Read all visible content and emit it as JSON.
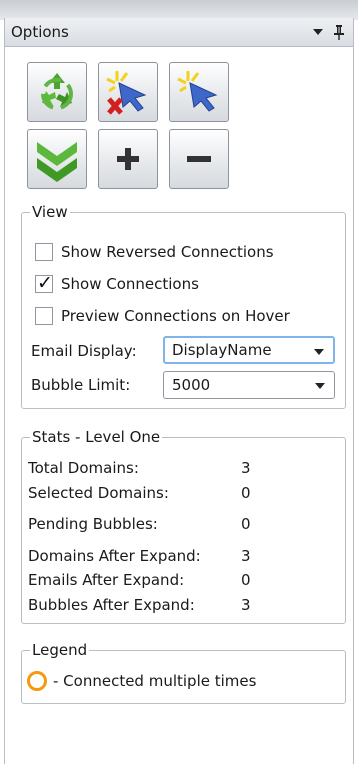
{
  "panel": {
    "title": "Options"
  },
  "toolbar": {
    "buttons": [
      {
        "name": "refresh",
        "icon": "recycle-icon"
      },
      {
        "name": "clear-selection",
        "icon": "cursor-x-icon"
      },
      {
        "name": "select",
        "icon": "cursor-sparkle-icon"
      },
      {
        "name": "expand",
        "icon": "double-chevron-down-icon"
      },
      {
        "name": "zoom-in",
        "icon": "plus-icon",
        "label": "+"
      },
      {
        "name": "zoom-out",
        "icon": "minus-icon",
        "label": "−"
      }
    ]
  },
  "view": {
    "legend": "View",
    "options": [
      {
        "label": "Show Reversed Connections",
        "checked": false
      },
      {
        "label": "Show Connections",
        "checked": true
      },
      {
        "label": "Preview Connections on Hover",
        "checked": false
      }
    ],
    "email_display": {
      "label": "Email Display:",
      "value": "DisplayName"
    },
    "bubble_limit": {
      "label": "Bubble Limit:",
      "value": "5000"
    }
  },
  "stats": {
    "legend": "Stats - Level One",
    "rows": [
      {
        "label": "Total Domains:",
        "value": "3"
      },
      {
        "label": "Selected Domains:",
        "value": "0"
      },
      {
        "label": "Pending Bubbles:",
        "value": "0"
      },
      {
        "label": "Domains After Expand:",
        "value": "3"
      },
      {
        "label": "Emails After Expand:",
        "value": "0"
      },
      {
        "label": "Bubbles After Expand:",
        "value": "3"
      }
    ]
  },
  "legend_box": {
    "legend": "Legend",
    "items": [
      {
        "label": "- Connected multiple times",
        "color": "#f39a10"
      }
    ]
  }
}
